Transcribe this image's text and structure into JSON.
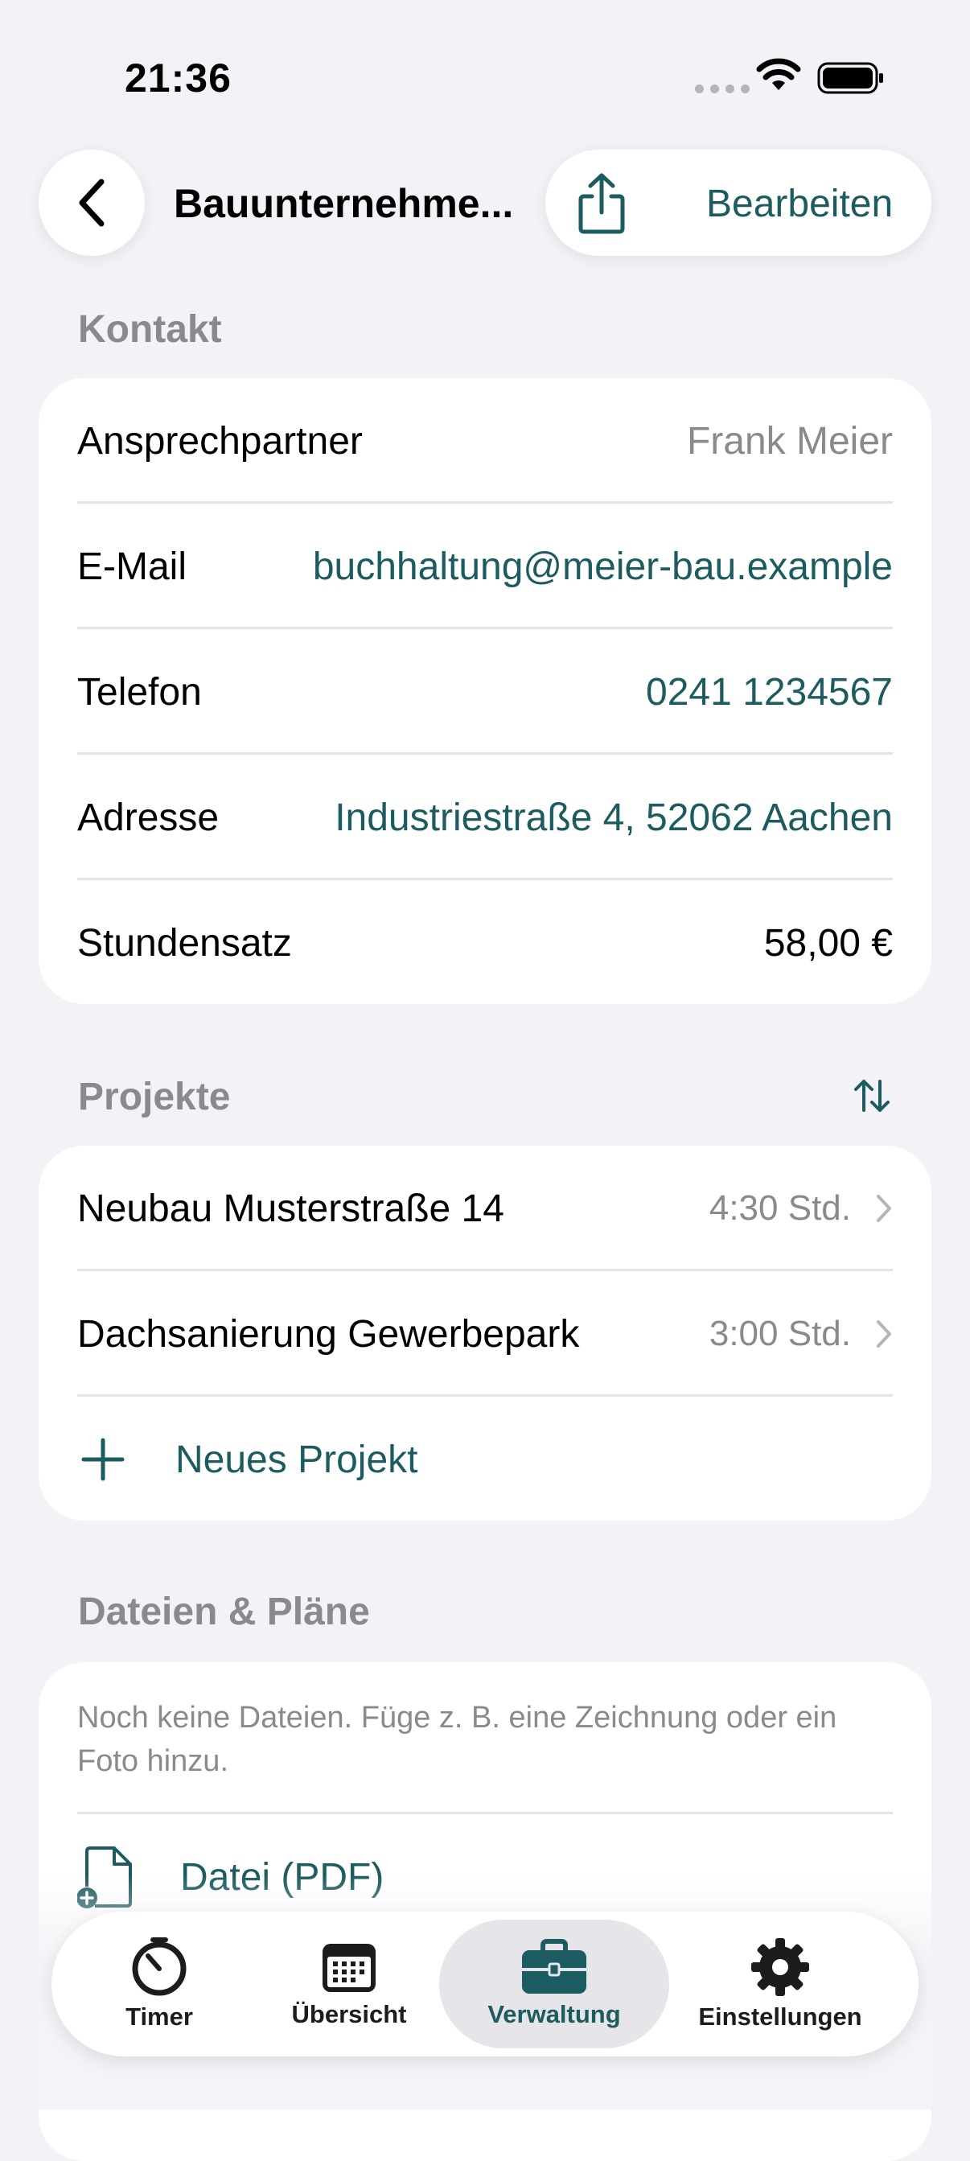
{
  "status_bar": {
    "time": "21:36"
  },
  "nav": {
    "title": "Bauunternehme...",
    "edit_label": "Bearbeiten"
  },
  "contact": {
    "header": "Kontakt",
    "rows": [
      {
        "label": "Ansprechpartner",
        "value": "Frank Meier",
        "style": "gray"
      },
      {
        "label": "E-Mail",
        "value": "buchhaltung@meier-bau.example",
        "style": "link"
      },
      {
        "label": "Telefon",
        "value": "0241 1234567",
        "style": "link"
      },
      {
        "label": "Adresse",
        "value": "Industriestraße 4, 52062 Aachen",
        "style": "link"
      },
      {
        "label": "Stundensatz",
        "value": "58,00 €",
        "style": "black"
      }
    ]
  },
  "projects": {
    "header": "Projekte",
    "sort_icon": "sort-arrows-icon",
    "items": [
      {
        "name": "Neubau Musterstraße 14",
        "hours": "4:30 Std."
      },
      {
        "name": "Dachsanierung Gewerbepark",
        "hours": "3:00 Std."
      }
    ],
    "new_label": "Neues Projekt"
  },
  "files": {
    "header": "Dateien & Pläne",
    "empty_text": "Noch keine Dateien. Füge z. B. eine Zeichnung oder ein Foto hinzu.",
    "pdf_label": "Datei (PDF)"
  },
  "tabs": [
    {
      "label": "Timer",
      "icon": "stopwatch-icon"
    },
    {
      "label": "Übersicht",
      "icon": "calendar-icon"
    },
    {
      "label": "Verwaltung",
      "icon": "briefcase-icon",
      "active": true
    },
    {
      "label": "Einstellungen",
      "icon": "gear-icon"
    }
  ],
  "colors": {
    "accent": "#1C5B5F",
    "background": "#F2F2F7",
    "secondary_text": "#8A8A8E"
  }
}
